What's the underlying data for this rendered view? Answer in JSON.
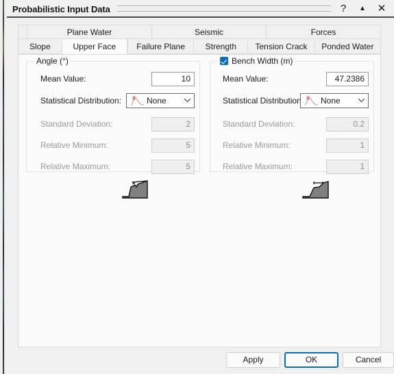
{
  "window": {
    "title": "Probabilistic Input Data",
    "controls": [
      {
        "name": "help-button",
        "glyph": "?"
      },
      {
        "name": "collapse-button",
        "glyph": "▲"
      },
      {
        "name": "close-button",
        "glyph": "✕"
      }
    ]
  },
  "tabs": {
    "top_row": [
      {
        "label": "Plane Water",
        "active": false
      },
      {
        "label": "Seismic",
        "active": false
      },
      {
        "label": "Forces",
        "active": false
      }
    ],
    "bottom_row": [
      {
        "label": "Slope",
        "active": false
      },
      {
        "label": "Upper Face",
        "active": true
      },
      {
        "label": "Failure Plane",
        "active": false
      },
      {
        "label": "Strength",
        "active": false
      },
      {
        "label": "Tension Crack",
        "active": false
      },
      {
        "label": "Ponded Water",
        "active": false
      }
    ],
    "active_tab": "Upper Face"
  },
  "groups": {
    "angle": {
      "legend": "Angle (°)",
      "has_checkbox": false,
      "mean_label": "Mean Value:",
      "mean_value": "10",
      "distribution_label": "Statistical Distribution:",
      "distribution_value": "None",
      "std_label": "Standard Deviation:",
      "std_value": "2",
      "relmin_label": "Relative Minimum:",
      "relmin_value": "5",
      "relmax_label": "Relative Maximum:",
      "relmax_value": "5"
    },
    "bench_width": {
      "legend": "Bench Width (m)",
      "has_checkbox": true,
      "checked": true,
      "mean_label": "Mean Value:",
      "mean_value": "47.2386",
      "distribution_label": "Statistical Distribution:",
      "distribution_value": "None",
      "std_label": "Standard Deviation:",
      "std_value": "0.2",
      "relmin_label": "Relative Minimum:",
      "relmin_value": "1",
      "relmax_label": "Relative Maximum:",
      "relmax_value": "1"
    }
  },
  "figures": {
    "angle_diagram": "slope-upper-face-angle-diagram",
    "bench_diagram": "slope-bench-width-diagram"
  },
  "icons": {
    "distribution": "distribution-curve-icon",
    "chevron": "⌄"
  },
  "footer": {
    "apply_label": "Apply",
    "ok_label": "OK",
    "cancel_label": "Cancel"
  },
  "colors": {
    "accent": "#0f6cbd",
    "panel": "#fbfbfb",
    "window": "#f0f0f0",
    "disabled_text": "#9a9a9a",
    "slope_fill": "#808080"
  }
}
